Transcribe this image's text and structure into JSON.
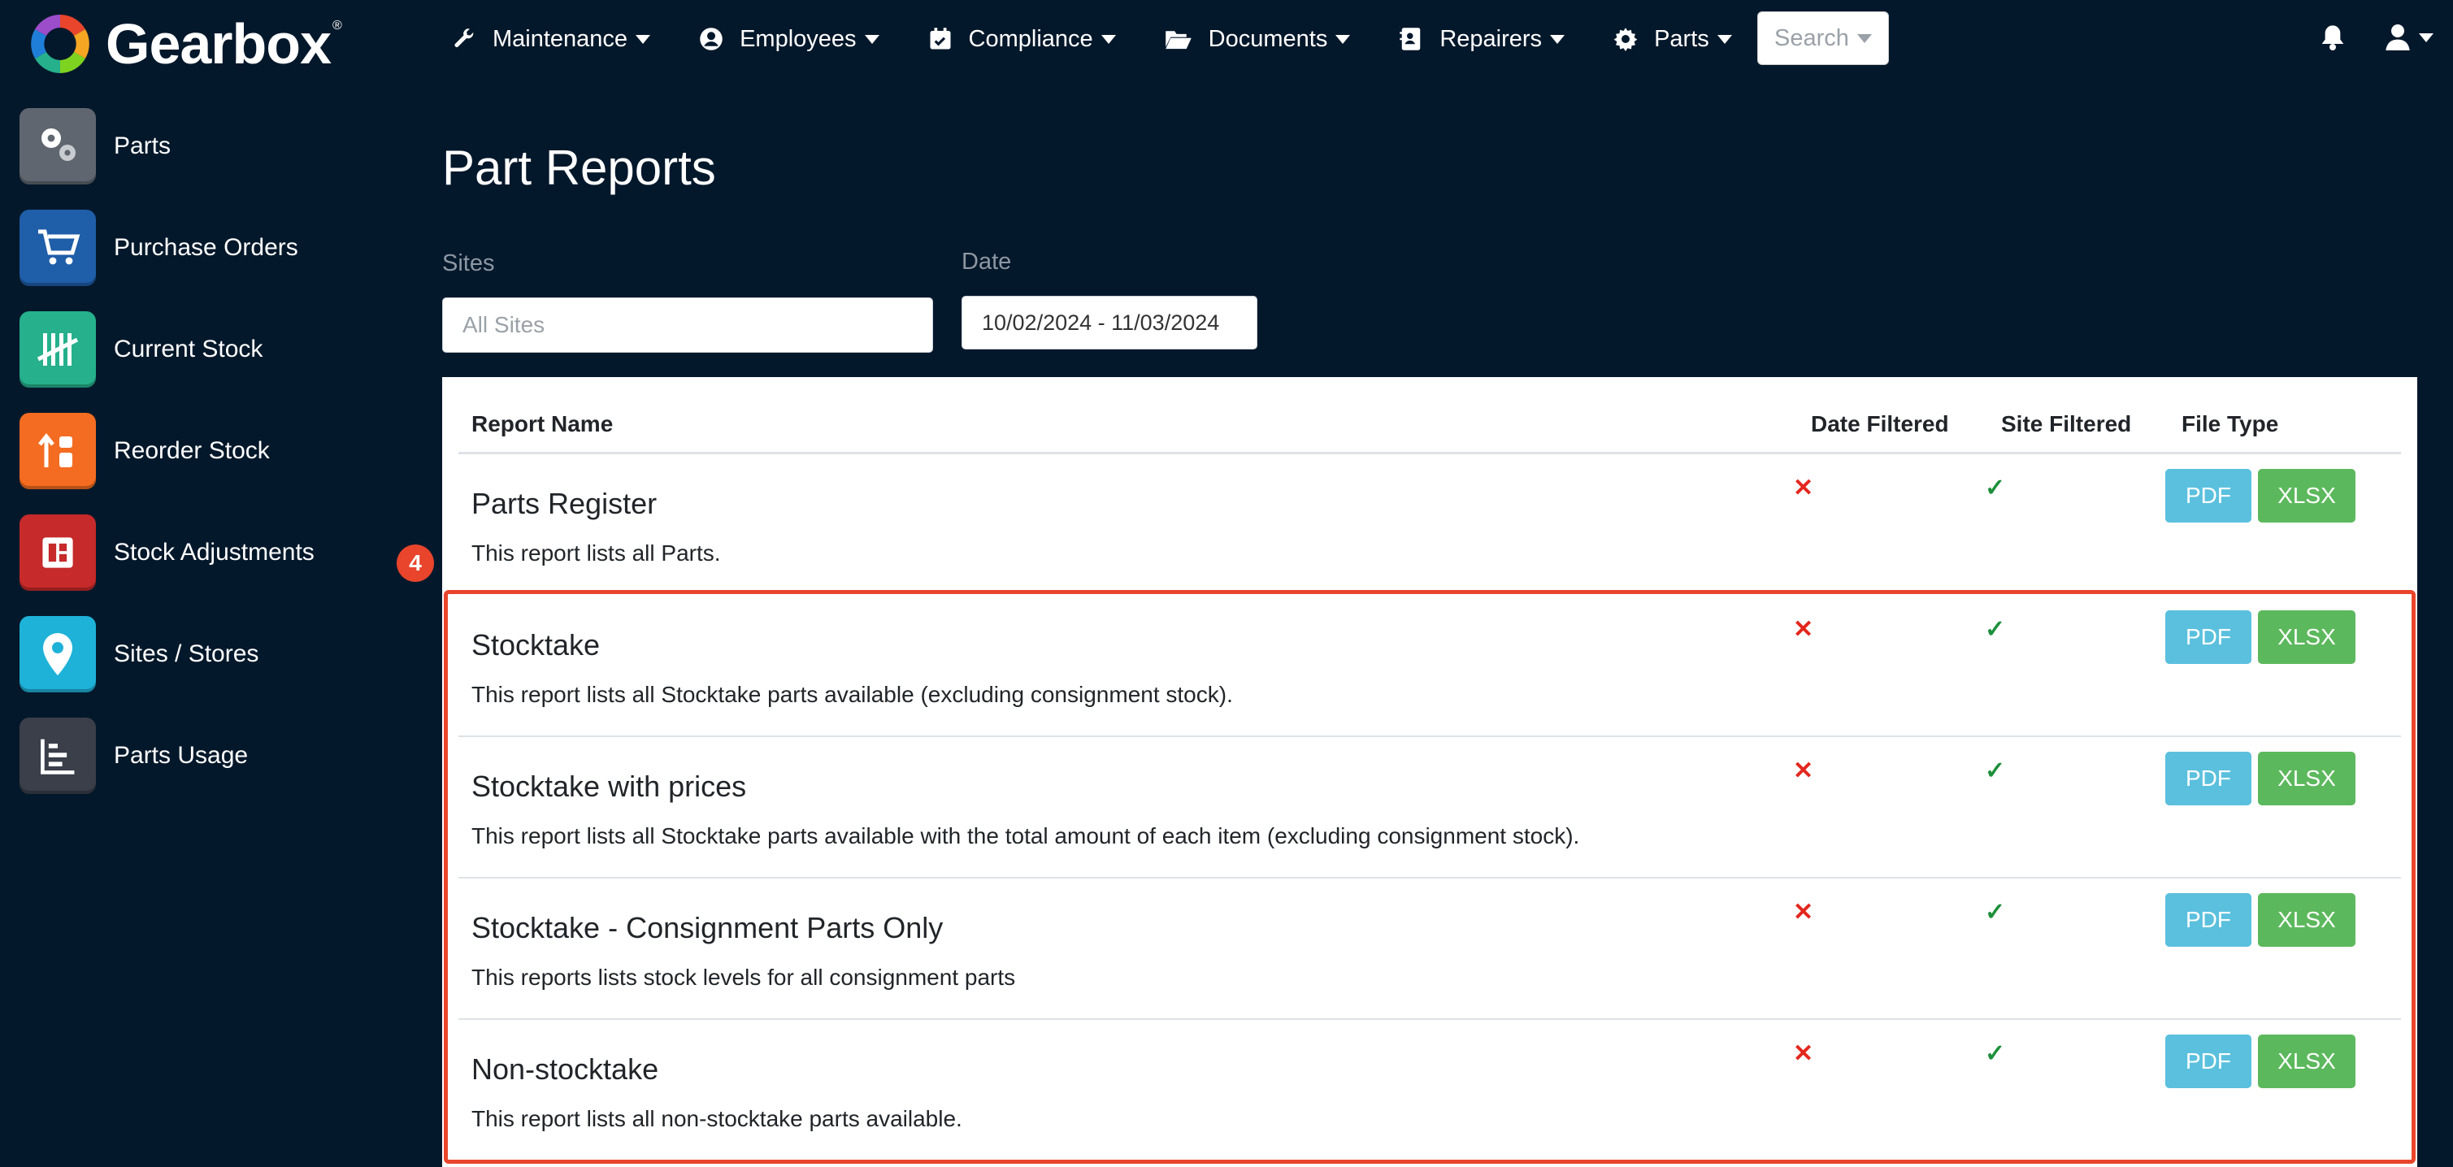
{
  "app": {
    "name": "Gearbox"
  },
  "nav": {
    "items": [
      {
        "label": "Maintenance",
        "icon": "wrench-icon"
      },
      {
        "label": "Employees",
        "icon": "user-circle-icon"
      },
      {
        "label": "Compliance",
        "icon": "calendar-check-icon"
      },
      {
        "label": "Documents",
        "icon": "folder-open-icon"
      },
      {
        "label": "Repairers",
        "icon": "contact-card-icon"
      },
      {
        "label": "Parts",
        "icon": "gear-icon"
      }
    ],
    "search_label": "Search"
  },
  "sidebar": {
    "items": [
      {
        "label": "Parts",
        "icon": "gears-icon",
        "color": "#5f6670"
      },
      {
        "label": "Purchase Orders",
        "icon": "cart-icon",
        "color": "#1f5ea8"
      },
      {
        "label": "Current Stock",
        "icon": "tally-icon",
        "color": "#26b08c"
      },
      {
        "label": "Reorder Stock",
        "icon": "reorder-icon",
        "color": "#f36c21"
      },
      {
        "label": "Stock Adjustments",
        "icon": "adjust-icon",
        "color": "#c62a2a"
      },
      {
        "label": "Sites / Stores",
        "icon": "map-pin-icon",
        "color": "#1fb2d8"
      },
      {
        "label": "Parts Usage",
        "icon": "bar-chart-icon",
        "color": "#3a3f4a"
      }
    ]
  },
  "page": {
    "title": "Part Reports"
  },
  "filters": {
    "sites_label": "Sites",
    "sites_placeholder": "All Sites",
    "date_label": "Date",
    "date_value": "10/02/2024 - 11/03/2024"
  },
  "table": {
    "headers": [
      "Report Name",
      "Date Filtered",
      "Site Filtered",
      "File Type"
    ],
    "rows": [
      {
        "title": "Parts Register",
        "description": "This report lists all Parts.",
        "date_filtered": "✕",
        "site_filtered": "✓",
        "pdf": "PDF",
        "xlsx": "XLSX"
      },
      {
        "title": "Stocktake",
        "description": "This report lists all Stocktake parts available (excluding consignment stock).",
        "date_filtered": "✕",
        "site_filtered": "✓",
        "pdf": "PDF",
        "xlsx": "XLSX"
      },
      {
        "title": "Stocktake with prices",
        "description": "This report lists all Stocktake parts available with the total amount of each item (excluding consignment stock).",
        "date_filtered": "✕",
        "site_filtered": "✓",
        "pdf": "PDF",
        "xlsx": "XLSX"
      },
      {
        "title": "Stocktake - Consignment Parts Only",
        "description": "This reports lists stock levels for all consignment parts",
        "date_filtered": "✕",
        "site_filtered": "✓",
        "pdf": "PDF",
        "xlsx": "XLSX"
      },
      {
        "title": "Non-stocktake",
        "description": "This report lists all non-stocktake parts available.",
        "date_filtered": "✕",
        "site_filtered": "✓",
        "pdf": "PDF",
        "xlsx": "XLSX"
      }
    ]
  },
  "annotation": {
    "step": "4",
    "color": "#e8452c"
  }
}
